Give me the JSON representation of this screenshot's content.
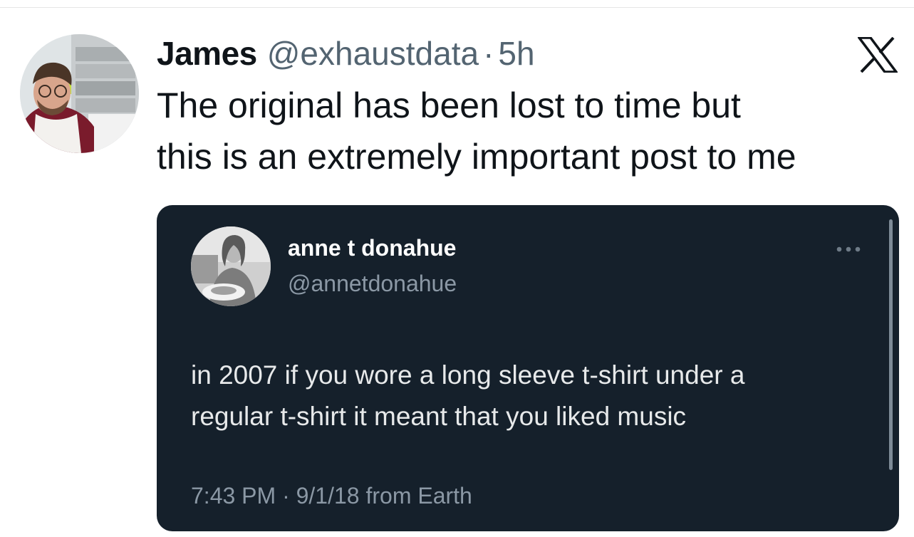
{
  "post": {
    "author_name": "James",
    "author_handle": "@exhaustdata",
    "separator": "·",
    "age": "5h",
    "text_line1": "The original has been lost to time but",
    "text_line2": "this is an extremely important post to me",
    "platform_icon": "x-logo-icon"
  },
  "quoted": {
    "name": "anne t donahue",
    "handle": "@annetdonahue",
    "more_icon": "more-options-icon",
    "text_line1": "in 2007 if you wore a long sleeve t-shirt under a",
    "text_line2": "regular t-shirt it meant that you liked music",
    "meta": "7:43 PM · 9/1/18 from Earth"
  },
  "colors": {
    "card_background": "#15202b",
    "primary_text": "#0f1419",
    "secondary_text": "#536471",
    "quote_text": "#e7e9ea",
    "quote_secondary": "#8b98a5"
  }
}
